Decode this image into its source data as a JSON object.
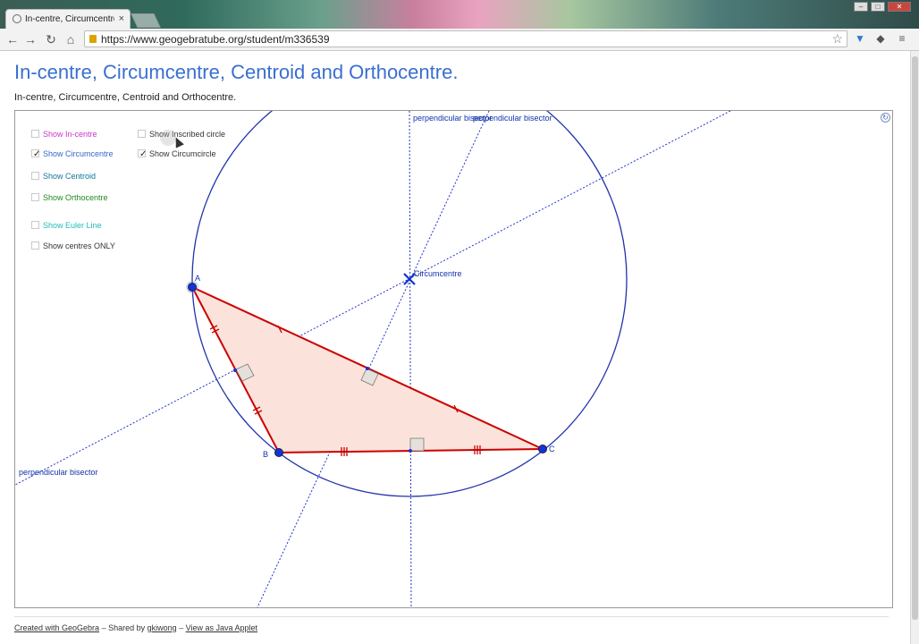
{
  "browser": {
    "tab_title": "In-centre, Circumcentre,",
    "tab_close": "×",
    "url": "https://www.geogebratube.org/student/m336539",
    "icons": [
      "back-icon",
      "forward-icon",
      "reload-icon",
      "home-icon",
      "lock-icon",
      "star-icon",
      "extension-icon",
      "menu-icon"
    ]
  },
  "page": {
    "title": "In-centre, Circumcentre, Centroid and Orthocentre.",
    "subtitle": "In-centre, Circumcentre, Centroid and Orthocentre."
  },
  "checkboxes": [
    {
      "label": "Show In-centre",
      "checked": false,
      "color": "#cc33cc"
    },
    {
      "label": "Show Circumcentre",
      "checked": true,
      "color": "#3366cc"
    },
    {
      "label": "Show Centroid",
      "checked": false,
      "color": "#117799"
    },
    {
      "label": "Show Orthocentre",
      "checked": false,
      "color": "#228822"
    },
    {
      "label": "Show Euler Line",
      "checked": false,
      "color": "#22bbbb"
    },
    {
      "label": "Show centres ONLY",
      "checked": false,
      "color": "#333333"
    },
    {
      "label": "Show Inscribed circle",
      "checked": false,
      "color": "#333333"
    },
    {
      "label": "Show Circumcircle",
      "checked": true,
      "color": "#333333"
    }
  ],
  "check_mark": "✓",
  "geometry": {
    "labels": {
      "A": "A",
      "B": "B",
      "C": "C",
      "circumcentre": "Circumcentre",
      "bisector1": "perpendicular bisector",
      "bisector2": "perpendicular bisector",
      "bisector3": "perpendicular bisector"
    },
    "colors": {
      "triangle_edge": "#cc0000",
      "triangle_fill": "#fbe3dc",
      "circle": "#2233aa",
      "bisector": "#2233cc",
      "point": "#1133dd"
    }
  },
  "footer": {
    "created": "Created with GeoGebra",
    "sep1": " – Shared by ",
    "user": "gkiwong",
    "sep2": " – ",
    "java": "View as Java Applet"
  }
}
